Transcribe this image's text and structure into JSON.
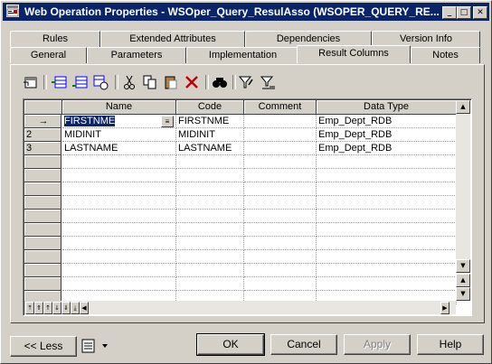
{
  "window": {
    "title": "Web Operation Properties - WSOper_Query_ResulAsso (WSOPER_QUERY_RE...",
    "controls": {
      "minimize": "_",
      "maximize": "□",
      "close": "✕"
    }
  },
  "tabs": {
    "row_back": [
      "Rules",
      "Extended Attributes",
      "Dependencies",
      "Version Info"
    ],
    "row_front": [
      "General",
      "Parameters",
      "Implementation",
      "Result Columns",
      "Notes"
    ],
    "active": "Result Columns"
  },
  "toolbar": {
    "icons": [
      "properties-icon",
      "insert-row-icon",
      "add-row-icon",
      "add-rows-icon",
      "cut-icon",
      "copy-icon",
      "paste-icon",
      "delete-icon",
      "find-icon",
      "filter-icon",
      "clear-filter-icon"
    ]
  },
  "grid": {
    "columns": [
      "Name",
      "Code",
      "Comment",
      "Data Type"
    ],
    "rows": [
      {
        "num": "→",
        "name": "FIRSTNME",
        "code": "FIRSTNME",
        "comment": "",
        "datatype": "Emp_Dept_RDB",
        "selected": true
      },
      {
        "num": "2",
        "name": "MIDINIT",
        "code": "MIDINIT",
        "comment": "",
        "datatype": "Emp_Dept_RDB",
        "selected": false
      },
      {
        "num": "3",
        "name": "LASTNAME",
        "code": "LASTNAME",
        "comment": "",
        "datatype": "Emp_Dept_RDB",
        "selected": false
      }
    ],
    "ellipsis": "≡"
  },
  "buttons": {
    "less": "<< Less",
    "ok": "OK",
    "cancel": "Cancel",
    "apply": "Apply",
    "help": "Help"
  },
  "colors": {
    "titlebar": "#0a246a",
    "selection": "#0a246a",
    "face": "#d4d0c8"
  }
}
